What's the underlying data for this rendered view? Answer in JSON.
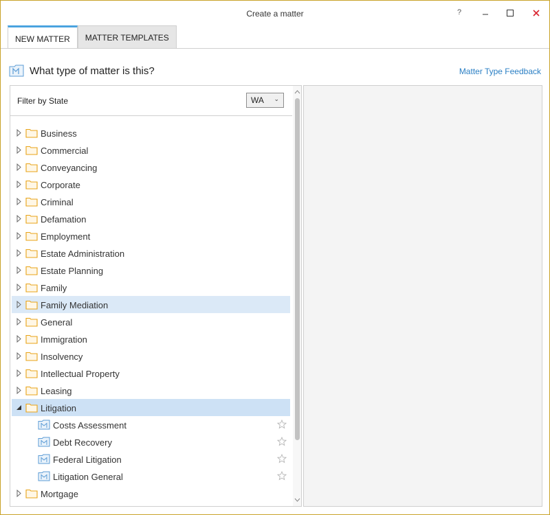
{
  "window": {
    "title": "Create a matter",
    "help_label": "?"
  },
  "tabs": [
    {
      "label": "NEW MATTER",
      "active": true
    },
    {
      "label": "MATTER TEMPLATES",
      "active": false
    }
  ],
  "header": {
    "question": "What type of matter is this?",
    "feedback_link": "Matter Type Feedback"
  },
  "filter": {
    "label": "Filter by State",
    "selected_state": "WA"
  },
  "tree": {
    "items": [
      {
        "label": "Business",
        "type": "folder"
      },
      {
        "label": "Commercial",
        "type": "folder"
      },
      {
        "label": "Conveyancing",
        "type": "folder"
      },
      {
        "label": "Corporate",
        "type": "folder"
      },
      {
        "label": "Criminal",
        "type": "folder"
      },
      {
        "label": "Defamation",
        "type": "folder"
      },
      {
        "label": "Employment",
        "type": "folder"
      },
      {
        "label": "Estate Administration",
        "type": "folder"
      },
      {
        "label": "Estate Planning",
        "type": "folder"
      },
      {
        "label": "Family",
        "type": "folder"
      },
      {
        "label": "Family Mediation",
        "type": "folder",
        "state": "hover"
      },
      {
        "label": "General",
        "type": "folder"
      },
      {
        "label": "Immigration",
        "type": "folder"
      },
      {
        "label": "Insolvency",
        "type": "folder"
      },
      {
        "label": "Intellectual Property",
        "type": "folder"
      },
      {
        "label": "Leasing",
        "type": "folder"
      },
      {
        "label": "Litigation",
        "type": "folder",
        "state": "selected",
        "expanded": true
      },
      {
        "label": "Costs Assessment",
        "type": "matter"
      },
      {
        "label": "Debt Recovery",
        "type": "matter"
      },
      {
        "label": "Federal Litigation",
        "type": "matter"
      },
      {
        "label": "Litigation General",
        "type": "matter"
      },
      {
        "label": "Mortgage",
        "type": "folder"
      }
    ]
  },
  "colors": {
    "accent": "#4aa3df",
    "link": "#2a7fc4",
    "folder": "#e8a317",
    "close": "#d9232e",
    "hover_row": "#dbe9f7",
    "selected_row": "#cde1f5"
  },
  "icons": {
    "folder": "folder-icon",
    "matter": "matter-type-icon",
    "favorite": "star-icon"
  }
}
